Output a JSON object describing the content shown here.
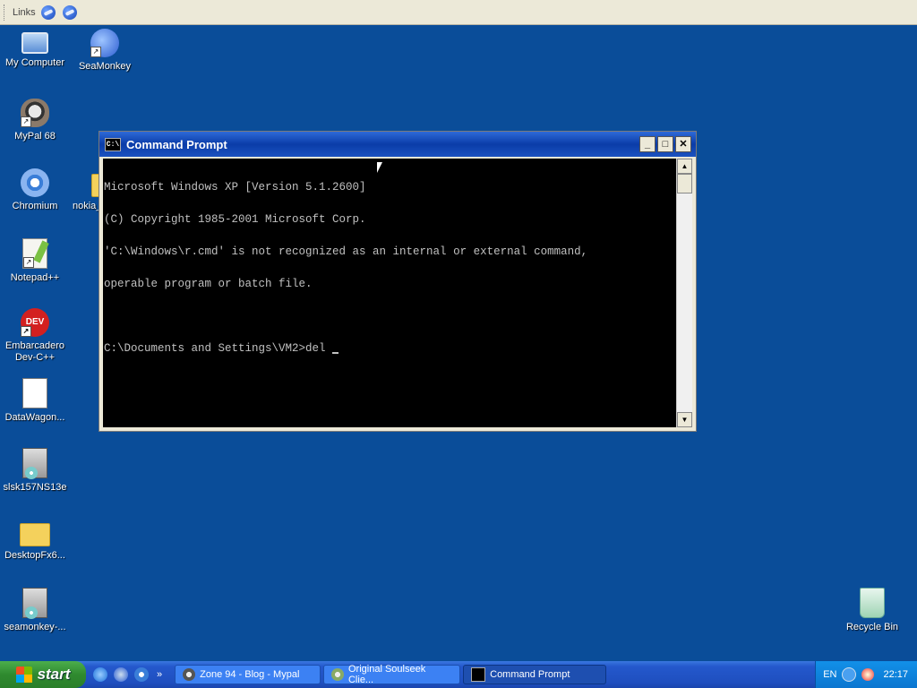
{
  "links_bar": {
    "label": "Links"
  },
  "desktop": {
    "icons": [
      {
        "label": "My Computer"
      },
      {
        "label": "SeaMonkey"
      },
      {
        "label": "MyPal 68"
      },
      {
        "label": "Chromium"
      },
      {
        "label": "nokia_"
      },
      {
        "label": "Notepad++"
      },
      {
        "label": "Embarcadero Dev-C++"
      },
      {
        "label": "DataWagon..."
      },
      {
        "label": "slsk157NS13e"
      },
      {
        "label": "DesktopFx6..."
      },
      {
        "label": "seamonkey-..."
      },
      {
        "label": "Recycle Bin"
      }
    ]
  },
  "cmd_window": {
    "title": "Command Prompt",
    "icon_text": "C:\\",
    "buttons": {
      "minimize": "_",
      "maximize": "□",
      "close": "✕"
    },
    "lines": [
      "Microsoft Windows XP [Version 5.1.2600]",
      "(C) Copyright 1985-2001 Microsoft Corp.",
      "'C:\\Windows\\r.cmd' is not recognized as an internal or external command,",
      "operable program or batch file.",
      "",
      "C:\\Documents and Settings\\VM2>del "
    ]
  },
  "taskbar": {
    "start_label": "start",
    "quick_launch_more": "»",
    "tasks": [
      {
        "label": "Zone 94 - Blog - Mypal"
      },
      {
        "label": "Original Soulseek Clie..."
      },
      {
        "label": "Command Prompt"
      }
    ],
    "tray": {
      "language": "EN",
      "clock": "22:17"
    }
  }
}
